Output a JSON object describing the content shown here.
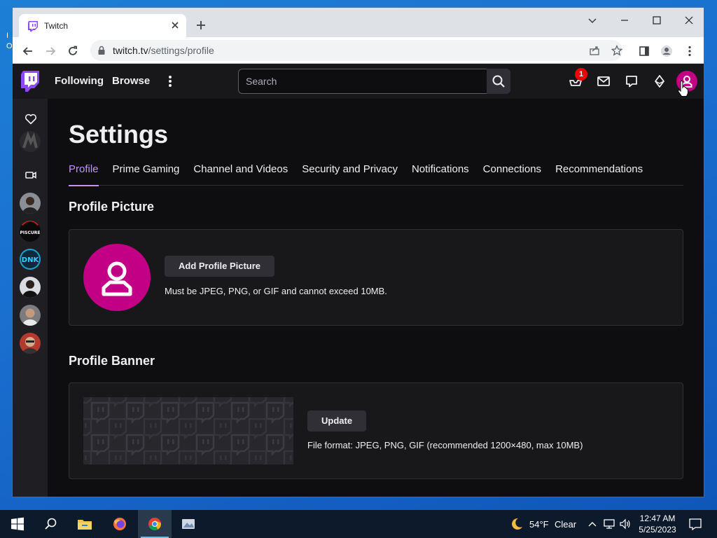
{
  "desktop": {
    "fragment": "I O"
  },
  "browser": {
    "tab_title": "Twitch",
    "url_host": "twitch.tv",
    "url_path": "/settings/profile"
  },
  "twitch_nav": {
    "following": "Following",
    "browse": "Browse",
    "search_placeholder": "Search",
    "notification_count": "1"
  },
  "settings": {
    "title": "Settings",
    "tabs": [
      {
        "label": "Profile",
        "active": true
      },
      {
        "label": "Prime Gaming"
      },
      {
        "label": "Channel and Videos"
      },
      {
        "label": "Security and Privacy"
      },
      {
        "label": "Notifications"
      },
      {
        "label": "Connections"
      },
      {
        "label": "Recommendations"
      }
    ],
    "profile_picture": {
      "heading": "Profile Picture",
      "button": "Add Profile Picture",
      "hint": "Must be JPEG, PNG, or GIF and cannot exceed 10MB."
    },
    "profile_banner": {
      "heading": "Profile Banner",
      "button": "Update",
      "hint": "File format: JPEG, PNG, GIF (recommended 1200×480, max 10MB)"
    }
  },
  "side_avatars": [
    {
      "label": "PISCURE"
    },
    {
      "label": "DNK"
    }
  ],
  "taskbar": {
    "temperature": "54°F",
    "weather": "Clear",
    "time": "12:47 AM",
    "date": "5/25/2023"
  },
  "colors": {
    "twitch_purple": "#9146ff",
    "accent_purple": "#bf94ff",
    "avatar_magenta": "#c30085",
    "badge_red": "#eb0400"
  }
}
